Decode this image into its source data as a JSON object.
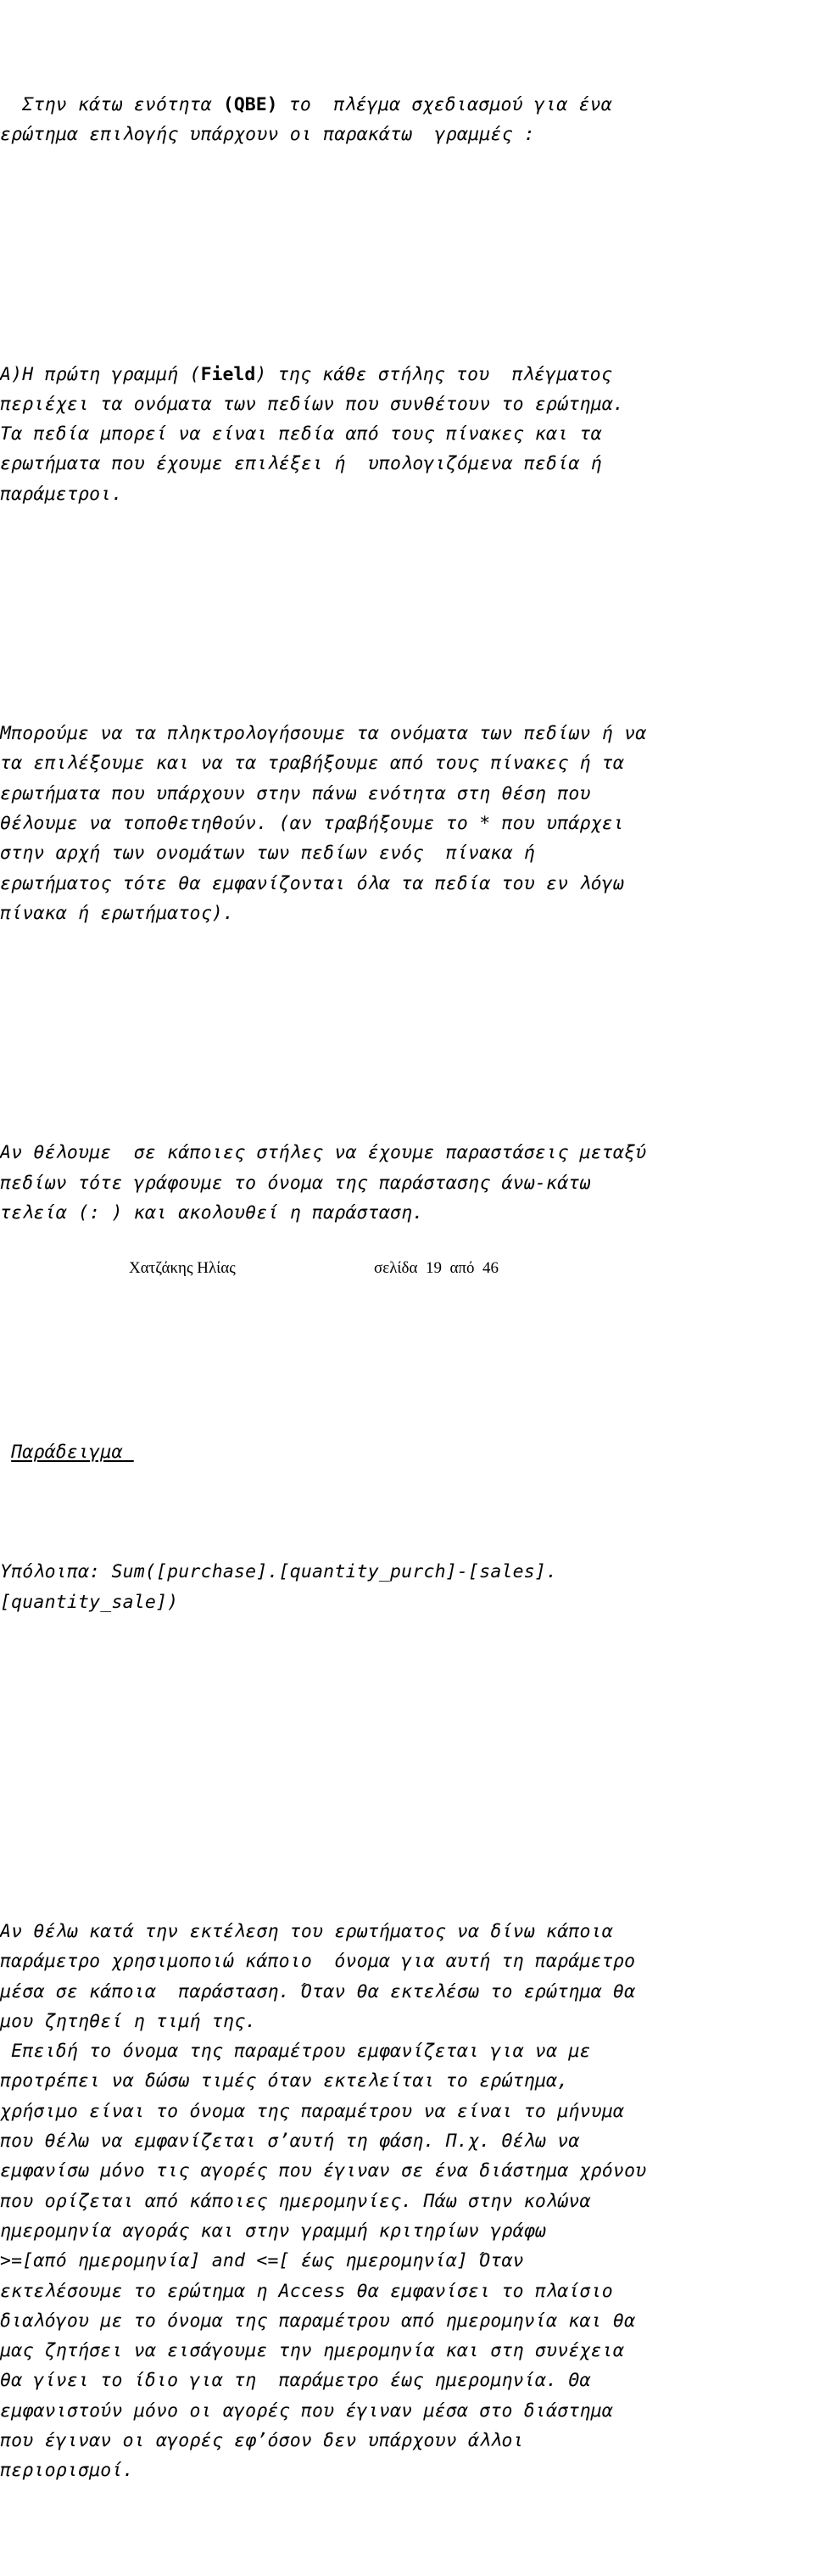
{
  "document": {
    "language": "el",
    "background_color": "#ffffff",
    "text_color": "#000000"
  },
  "content": {
    "p1_line1_a": "  Στην κάτω ενότητα ",
    "p1_bold1": "(QBE)",
    "p1_line1_b": " το  πλέγμα σχεδιασμού για ένα\nερώτημα επιλογής υπάρχουν οι παρακάτω  γραμμές :",
    "p2_a": "Α)Η πρώτη γραμμή (",
    "p2_bold": "Field",
    "p2_b": ") της κάθε στήλης του  πλέγματος\nπεριέχει τα ονόματα των πεδίων που συνθέτουν το ερώτημα.\nΤα πεδία μπορεί να είναι πεδία από τους πίνακες και τα\nερωτήματα που έχουμε επιλέξει ή  υπολογιζόμενα πεδία ή\nπαράμετροι.",
    "p3": "Μπορούμε να τα πληκτρολογήσουμε τα ονόματα των πεδίων ή να\nτα επιλέξουμε και να τα τραβήξουμε από τους πίνακες ή τα\nερωτήματα που υπάρχουν στην πάνω ενότητα στη θέση που\nθέλουμε να τοποθετηθούν. (αν τραβήξουμε το * που υπάρχει\nστην αρχή των ονομάτων των πεδίων ενός  πίνακα ή\nερωτήματος τότε θα εμφανίζονται όλα τα πεδία του εν λόγω\nπίνακα ή ερωτήματος).",
    "p4": "Αν θέλουμε  σε κάποιες στήλες να έχουμε παραστάσεις μεταξύ\nπεδίων τότε γράφουμε το όνομα της παράστασης άνω-κάτω\nτελεία (: ) και ακολουθεί η παράσταση.",
    "p5_heading": "Παράδειγμα ",
    "p5_heading_indent": " ",
    "p5_body": "Υπόλοιπα: Sum([purchase].[quantity_purch]-[sales].\n[quantity_sale])",
    "p6": "Αν θέλω κατά την εκτέλεση του ερωτήματος να δίνω κάποια\nπαράμετρο χρησιμοποιώ κάποιο  όνομα για αυτή τη παράμετρο\nμέσα σε κάποια  παράσταση. Όταν θα εκτελέσω το ερώτημα θα\nμου ζητηθεί η τιμή της.\n Επειδή το όνομα της παραμέτρου εμφανίζεται για να με\nπροτρέπει να δώσω τιμές όταν εκτελείται το ερώτημα,\nχρήσιμο είναι το όνομα της παραμέτρου να είναι το μήνυμα\nπου θέλω να εμφανίζεται σ’αυτή τη φάση. Π.χ. Θέλω να\nεμφανίσω μόνο τις αγορές που έγιναν σε ένα διάστημα χρόνου\nπου ορίζεται από κάποιες ημερομηνίες. Πάω στην κολώνα\nημερομηνία αγοράς και στην γραμμή κριτηρίων γράφω\n>=[από ημερομηνία] and <=[ έως ημερομηνία] Όταν\nεκτελέσουμε το ερώτημα η Access θα εμφανίσει το πλαίσιο\nδιαλόγου με το όνομα της παραμέτρου από ημερομηνία και θα\nμας ζητήσει να εισάγουμε την ημερομηνία και στη συνέχεια\nθα γίνει το ίδιο για τη  παράμετρο έως ημερομηνία. Θα\nεμφανιστούν μόνο οι αγορές που έγιναν μέσα στο διάστημα\nπου έγιναν οι αγορές εφ’όσον δεν υπάρχουν άλλοι\nπεριορισμοί."
  },
  "footer": {
    "author": "Χατζάκης Ηλίας",
    "page_info": "σελίδα  19  από  46",
    "page_number": "19",
    "total_pages": "46"
  }
}
